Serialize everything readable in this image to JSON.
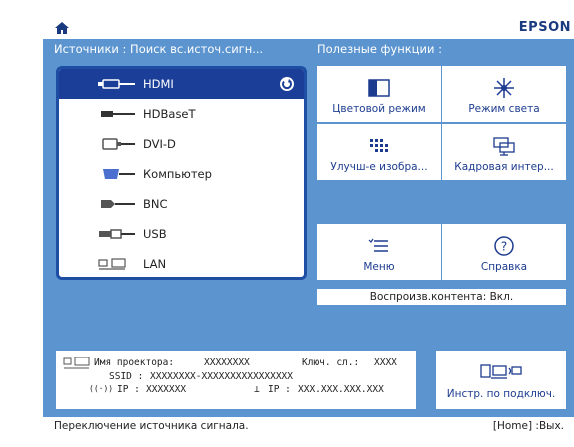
{
  "brand": "EPSON",
  "sources_header": "Источники : Поиск вс.источ.сигн...",
  "util_header": "Полезные функции :",
  "sources": [
    {
      "label": "HDMI",
      "icon": "hdmi-icon",
      "selected": true
    },
    {
      "label": "HDBaseT",
      "icon": "hdbaset-icon"
    },
    {
      "label": "DVI-D",
      "icon": "dvi-icon"
    },
    {
      "label": "Компьютер",
      "icon": "computer-port-icon"
    },
    {
      "label": "BNC",
      "icon": "bnc-icon"
    },
    {
      "label": "USB",
      "icon": "usb-icon"
    },
    {
      "label": "LAN",
      "icon": "lan-icon"
    }
  ],
  "utilities": {
    "color_mode": "Цветовой режим",
    "light_mode": "Режим света",
    "image_enh": "Улучш-е изобра...",
    "frame_interp": "Кадровая интер...",
    "menu": "Меню",
    "help": "Справка"
  },
  "content_playback": "Воспроизв.контента: Вкл.",
  "info": {
    "projector_name_label": "Имя проектора:",
    "projector_name": "XXXXXXXX",
    "key_label": "Ключ. сл.:",
    "key": "XXXX",
    "ssid_label": "SSID :",
    "ssid": "XXXXXXXX-XXXXXXXXXXXXXXXX",
    "wifi_ip_label": "IP :",
    "wifi_ip": "XXXXXXX",
    "lan_ip_label": "IP :",
    "lan_ip": "XXX.XXX.XXX.XXX"
  },
  "connect_tool": "Инстр. по подключ.",
  "footer": {
    "hint": "Переключение источника сигнала.",
    "exit": "[Home] :Вых."
  },
  "colors": {
    "background": "#5b94cf",
    "selection": "#1b3f98",
    "accent_text": "#1d3c8f"
  }
}
